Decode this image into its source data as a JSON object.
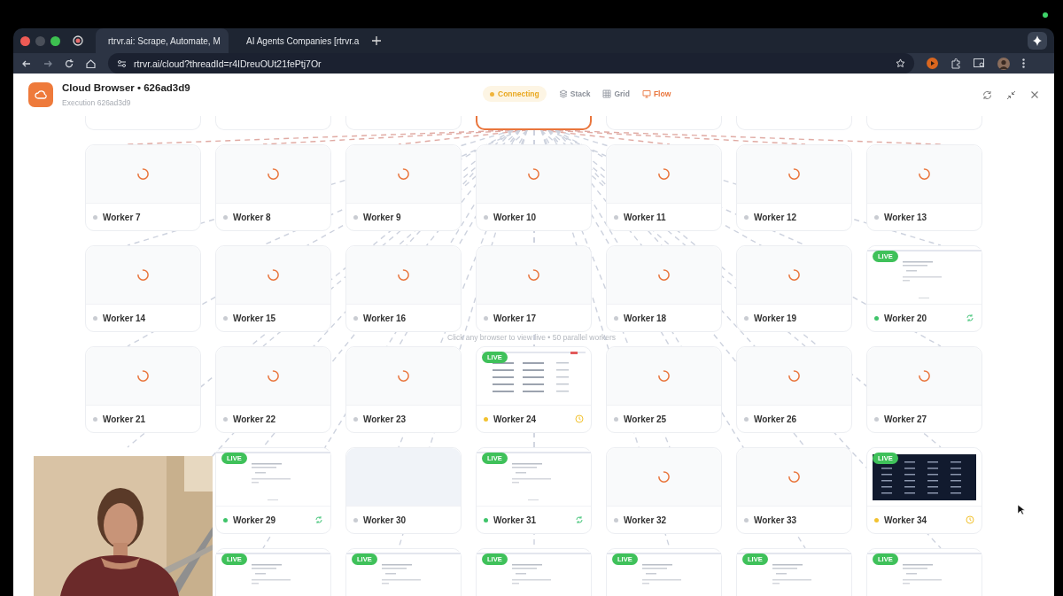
{
  "browser": {
    "tabs": [
      {
        "title": "rtrvr.ai: Scrape, Automate, M",
        "selected": true
      },
      {
        "title": "AI Agents Companies [rtrvr.a",
        "selected": false
      }
    ],
    "url": "rtrvr.ai/cloud?threadId=r4IDreuOUt21fePtj7Or"
  },
  "header": {
    "title": "Cloud Browser • 626ad3d9",
    "subtitle": "Execution 626ad3d9",
    "status": "Connecting",
    "views": [
      {
        "label": "Stack",
        "selected": false
      },
      {
        "label": "Grid",
        "selected": false
      },
      {
        "label": "Flow",
        "selected": true
      }
    ]
  },
  "canvas": {
    "hint": "Click any browser to view live • 50 parallel workers",
    "row_above": [
      {
        "highlighted": false
      },
      {
        "highlighted": false
      },
      {
        "highlighted": false
      },
      {
        "highlighted": true
      },
      {
        "highlighted": false
      },
      {
        "highlighted": false
      },
      {
        "highlighted": false
      }
    ],
    "rows": [
      {
        "cards": [
          {
            "name": "Worker 7",
            "kind": "loading",
            "color": "#c9ccd2",
            "syncing": false,
            "waiting": false
          },
          {
            "name": "Worker 8",
            "kind": "loading",
            "color": "#c9ccd2",
            "syncing": false,
            "waiting": false
          },
          {
            "name": "Worker 9",
            "kind": "loading",
            "color": "#c9ccd2",
            "syncing": false,
            "waiting": false
          },
          {
            "name": "Worker 10",
            "kind": "loading",
            "color": "#c9ccd2",
            "syncing": false,
            "waiting": false
          },
          {
            "name": "Worker 11",
            "kind": "loading",
            "color": "#c9ccd2",
            "syncing": false,
            "waiting": false
          },
          {
            "name": "Worker 12",
            "kind": "loading",
            "color": "#c9ccd2",
            "syncing": false,
            "waiting": false
          },
          {
            "name": "Worker 13",
            "kind": "loading",
            "color": "#c9ccd2",
            "syncing": false,
            "waiting": false
          }
        ]
      },
      {
        "cards": [
          {
            "name": "Worker 14",
            "kind": "loading",
            "color": "#c9ccd2",
            "syncing": false,
            "waiting": false
          },
          {
            "name": "Worker 15",
            "kind": "loading",
            "color": "#c9ccd2",
            "syncing": false,
            "waiting": false
          },
          {
            "name": "Worker 16",
            "kind": "loading",
            "color": "#c9ccd2",
            "syncing": false,
            "waiting": false
          },
          {
            "name": "Worker 17",
            "kind": "loading",
            "color": "#c9ccd2",
            "syncing": false,
            "waiting": false
          },
          {
            "name": "Worker 18",
            "kind": "loading",
            "color": "#c9ccd2",
            "syncing": false,
            "waiting": false
          },
          {
            "name": "Worker 19",
            "kind": "loading",
            "color": "#c9ccd2",
            "syncing": false,
            "waiting": false
          },
          {
            "name": "Worker 20",
            "kind": "page",
            "badge": "LIVE",
            "color": "#3fc46a",
            "syncing": true,
            "waiting": false
          }
        ]
      },
      {
        "cards": [
          {
            "name": "Worker 21",
            "kind": "loading",
            "color": "#c9ccd2",
            "syncing": false,
            "waiting": false
          },
          {
            "name": "Worker 22",
            "kind": "loading",
            "color": "#c9ccd2",
            "syncing": false,
            "waiting": false
          },
          {
            "name": "Worker 23",
            "kind": "loading",
            "color": "#c9ccd2",
            "syncing": false,
            "waiting": false
          },
          {
            "name": "Worker 24",
            "kind": "table",
            "badge": "LIVE",
            "color": "#f2c230",
            "syncing": false,
            "waiting": true
          },
          {
            "name": "Worker 25",
            "kind": "loading",
            "color": "#c9ccd2",
            "syncing": false,
            "waiting": false
          },
          {
            "name": "Worker 26",
            "kind": "loading",
            "color": "#c9ccd2",
            "syncing": false,
            "waiting": false
          },
          {
            "name": "Worker 27",
            "kind": "loading",
            "color": "#c9ccd2",
            "syncing": false,
            "waiting": false
          }
        ]
      },
      {
        "cards": [
          {
            "name": "Worker 29",
            "kind": "page",
            "badge": "LIVE",
            "color": "#3fc46a",
            "syncing": true,
            "waiting": false
          },
          {
            "name": "Worker 30",
            "kind": "blank",
            "color": "#c9ccd2",
            "syncing": false,
            "waiting": false
          },
          {
            "name": "Worker 31",
            "kind": "page",
            "badge": "LIVE",
            "color": "#3fc46a",
            "syncing": true,
            "waiting": false
          },
          {
            "name": "Worker 32",
            "kind": "loading",
            "color": "#c9ccd2",
            "syncing": false,
            "waiting": false
          },
          {
            "name": "Worker 33",
            "kind": "loading",
            "color": "#c9ccd2",
            "syncing": false,
            "waiting": false
          },
          {
            "name": "Worker 34",
            "kind": "dark",
            "badge": "LIVE",
            "color": "#f2c230",
            "syncing": false,
            "waiting": true
          }
        ]
      },
      {
        "cards": [
          {
            "kind": "page",
            "badge": "LIVE"
          },
          {
            "kind": "page",
            "badge": "LIVE"
          },
          {
            "kind": "page",
            "badge": "LIVE"
          },
          {
            "kind": "page",
            "badge": "LIVE"
          },
          {
            "kind": "page",
            "badge": "LIVE"
          },
          {
            "kind": "page",
            "badge": "LIVE"
          }
        ]
      }
    ]
  }
}
